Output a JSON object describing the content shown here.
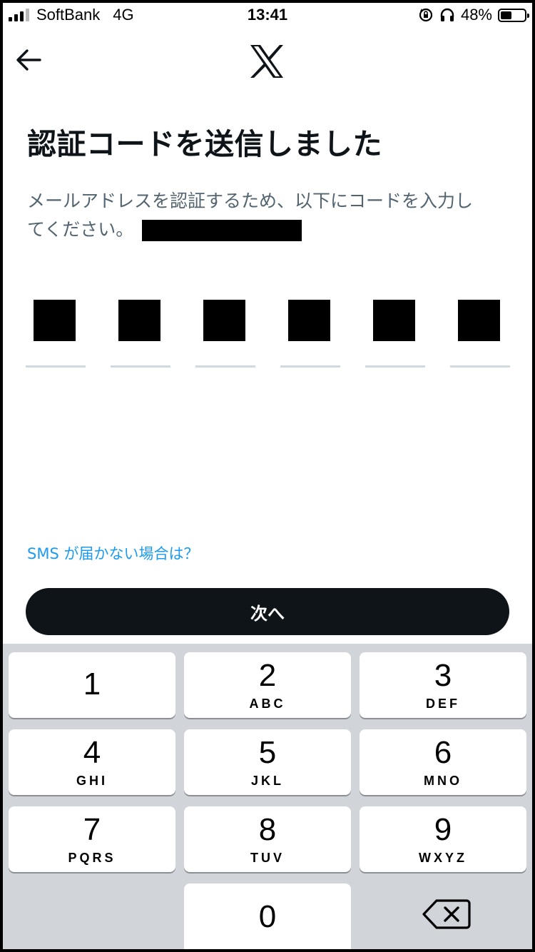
{
  "status_bar": {
    "carrier": "SoftBank",
    "network": "4G",
    "time": "13:41",
    "battery_percent": "48%",
    "battery_level": 0.48,
    "icons": [
      "signal-icon",
      "orientation-lock-icon",
      "headphones-icon",
      "battery-icon"
    ]
  },
  "header": {
    "back_icon": "back-arrow-icon",
    "logo": "x-logo-icon"
  },
  "main": {
    "title": "認証コードを送信しました",
    "description_line1": "メールアドレスを認証するため、以下にコードを入力し",
    "description_line2": "てください。",
    "code_length": 6,
    "sms_link": "SMS が届かない場合は？",
    "next_button": "次へ"
  },
  "keypad": {
    "keys": [
      {
        "num": "1",
        "letters": ""
      },
      {
        "num": "2",
        "letters": "ABC"
      },
      {
        "num": "3",
        "letters": "DEF"
      },
      {
        "num": "4",
        "letters": "GHI"
      },
      {
        "num": "5",
        "letters": "JKL"
      },
      {
        "num": "6",
        "letters": "MNO"
      },
      {
        "num": "7",
        "letters": "PQRS"
      },
      {
        "num": "8",
        "letters": "TUV"
      },
      {
        "num": "9",
        "letters": "WXYZ"
      },
      {
        "num": "0",
        "letters": ""
      }
    ],
    "backspace_icon": "backspace-icon"
  },
  "colors": {
    "text_primary": "#0f1419",
    "text_secondary": "#536471",
    "link": "#1d9bf0",
    "button_bg": "#0f1419",
    "keypad_bg": "#d1d4d9"
  }
}
